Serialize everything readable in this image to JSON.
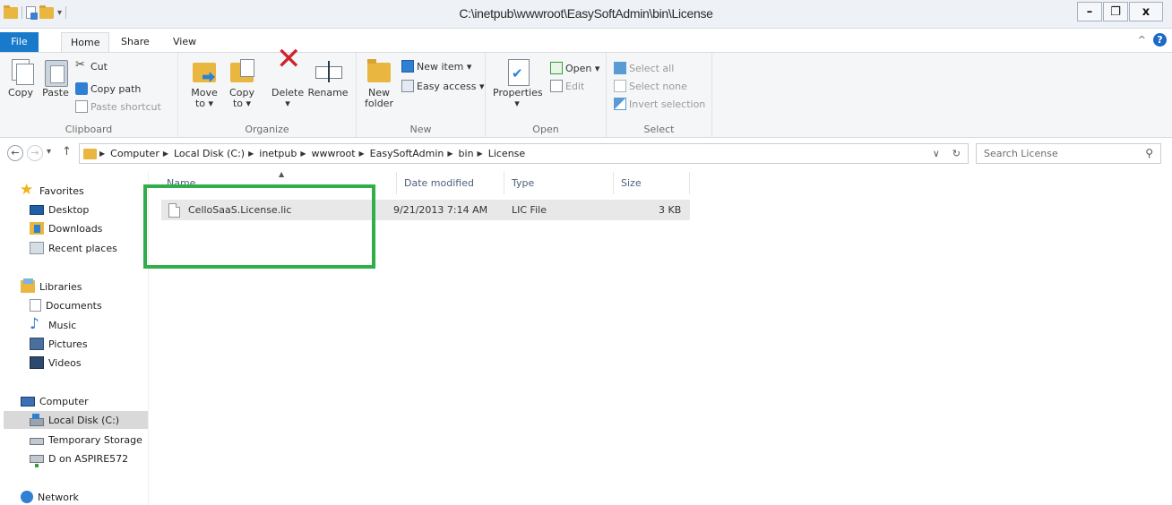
{
  "window": {
    "title": "C:\\inetpub\\wwwroot\\EasySoftAdmin\\bin\\License",
    "minimize": "–",
    "restore": "❐",
    "close": "x"
  },
  "quick_access": {
    "dropdown": "▾"
  },
  "ribbon_tabs": [
    {
      "label": "File"
    },
    {
      "label": "Home"
    },
    {
      "label": "Share"
    },
    {
      "label": "View"
    }
  ],
  "ribbon_help": {
    "collapse": "^",
    "help": "?"
  },
  "ribbon": {
    "clipboard": {
      "label": "Clipboard",
      "copy": "Copy",
      "paste": "Paste",
      "cut": "Cut",
      "copy_path": "Copy path",
      "paste_shortcut": "Paste shortcut"
    },
    "organize": {
      "label": "Organize",
      "move_to": "Move to ▾",
      "copy_to": "Copy to ▾",
      "delete": "Delete ▾",
      "rename": "Rename"
    },
    "new": {
      "label": "New",
      "new_folder": "New folder",
      "new_item": "New item ▾",
      "easy_access": "Easy access ▾"
    },
    "open": {
      "label": "Open",
      "properties": "Properties ▾",
      "open": "Open ▾",
      "edit": "Edit"
    },
    "select": {
      "label": "Select",
      "select_all": "Select all",
      "select_none": "Select none",
      "invert_selection": "Invert selection"
    }
  },
  "nav": {
    "back": "←",
    "forward": "→",
    "recent_dropdown": "▾",
    "up": "↑",
    "breadcrumb": [
      "Computer",
      "Local Disk (C:)",
      "inetpub",
      "wwwroot",
      "EasySoftAdmin",
      "bin",
      "License"
    ],
    "address_dropdown": "∨",
    "refresh": "↻",
    "search_placeholder": "Search License",
    "search_icon": "⚲"
  },
  "nav_pane": {
    "favorites": "Favorites",
    "desktop": "Desktop",
    "downloads": "Downloads",
    "recent_places": "Recent places",
    "libraries": "Libraries",
    "documents": "Documents",
    "music": "Music",
    "pictures": "Pictures",
    "videos": "Videos",
    "computer": "Computer",
    "local_disk": "Local Disk (C:)",
    "temporary_storage": "Temporary Storage",
    "d_on_aspire": "D on ASPIRE572",
    "network": "Network"
  },
  "columns": {
    "name": "Name",
    "date_modified": "Date modified",
    "type": "Type",
    "size": "Size",
    "sort_indicator": "▲"
  },
  "files": [
    {
      "name": "CelloSaaS.License.lic",
      "date_modified": "9/21/2013 7:14 AM",
      "type": "LIC File",
      "size": "3 KB"
    }
  ],
  "colors": {
    "file_tab": "#1979ca",
    "highlight_box": "#2fae4a",
    "selected_row": "#e8e8e8"
  }
}
